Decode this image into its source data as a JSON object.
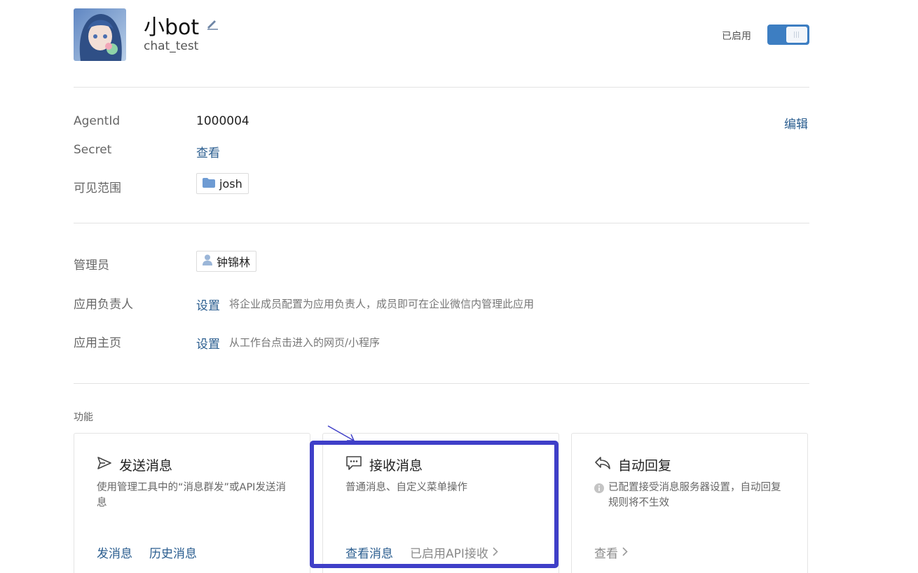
{
  "app": {
    "name": "小bot",
    "subtitle": "chat_test",
    "status_label": "已启用",
    "enabled": true,
    "avatar_desc": "anime-girl-avatar",
    "edit_icon": "pencil-icon"
  },
  "details": {
    "agentid_label": "AgentId",
    "agentid_value": "1000004",
    "edit_link": "编辑",
    "secret_label": "Secret",
    "secret_link": "查看",
    "visible_label": "可见范围",
    "visible_tag": "josh"
  },
  "admin": {
    "admin_label": "管理员",
    "admin_tag": "钟锦林",
    "owner_label": "应用负责人",
    "owner_link": "设置",
    "owner_desc": "将企业成员配置为应用负责人，成员即可在企业微信内管理此应用",
    "homepage_label": "应用主页",
    "homepage_link": "设置",
    "homepage_desc": "从工作台点击进入的网页/小程序"
  },
  "features": {
    "section_title": "功能",
    "cards": [
      {
        "title": "发送消息",
        "icon": "send-icon",
        "desc": "使用管理工具中的“消息群发”或API发送消息",
        "actions": [
          "发消息",
          "历史消息"
        ]
      },
      {
        "title": "接收消息",
        "icon": "chat-bubble-icon",
        "desc": "普通消息、自定义菜单操作",
        "actions": [
          "查看消息"
        ],
        "status": "已启用API接收"
      },
      {
        "title": "自动回复",
        "icon": "reply-icon",
        "desc": "已配置接受消息服务器设置，自动回复规则将不生效",
        "actions": [
          "查看"
        ]
      }
    ]
  },
  "colors": {
    "accent": "#3d7ec2",
    "link": "#2a5d8f",
    "highlight": "#3f3fc8"
  }
}
